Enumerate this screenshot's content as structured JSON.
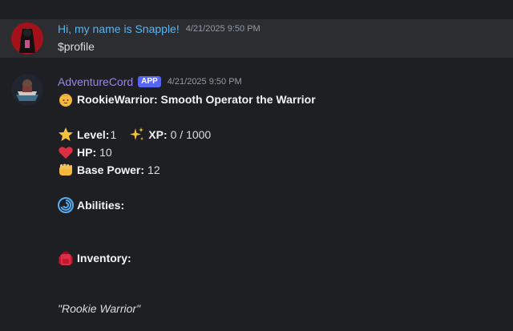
{
  "messages": [
    {
      "author": "Hi, my name is Snapple!",
      "author_color": "#5ab4f0",
      "timestamp": "4/21/2025 9:50 PM",
      "content": "$profile"
    },
    {
      "author": "AdventureCord",
      "author_color": "#9b84ec",
      "badge": "APP",
      "timestamp": "4/21/2025 9:50 PM",
      "profile": {
        "title_icon": "person-icon",
        "title": "RookieWarrior: Smooth Operator the Warrior",
        "level_icon": "star-icon",
        "level_label": "Level:",
        "level_value": "1",
        "xp_icon": "sparkles-icon",
        "xp_label": "XP:",
        "xp_value": "0 / 1000",
        "hp_icon": "heart-icon",
        "hp_label": "HP:",
        "hp_value": "10",
        "power_icon": "fist-icon",
        "power_label": "Base Power:",
        "power_value": "12",
        "abilities_icon": "cyclone-icon",
        "abilities_label": "Abilities:",
        "inventory_icon": "backpack-icon",
        "inventory_label": "Inventory:",
        "quote": "\"Rookie Warrior\""
      }
    }
  ]
}
